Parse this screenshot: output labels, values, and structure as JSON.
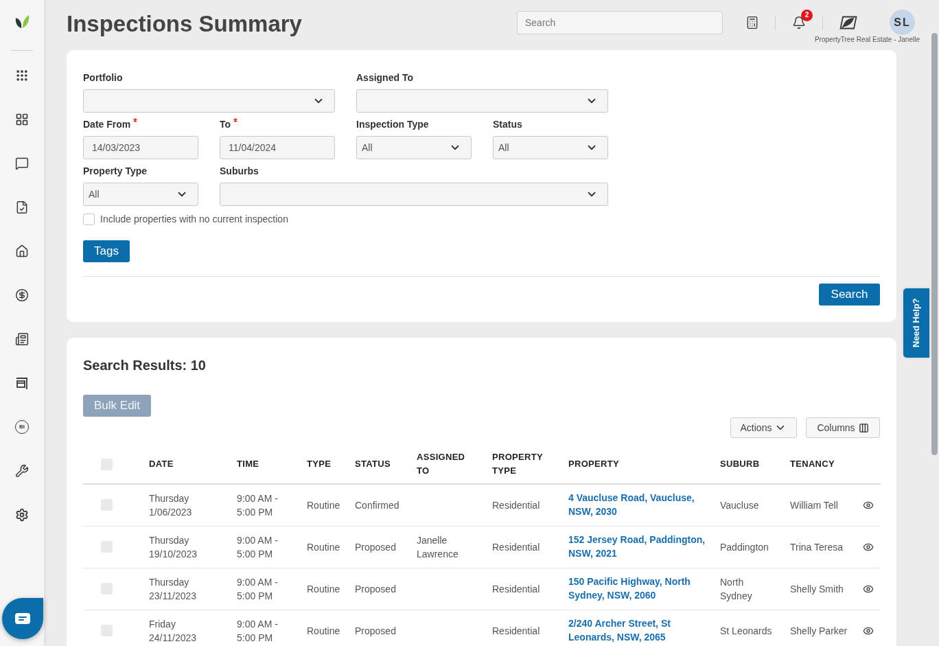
{
  "sidebar": {
    "bi_label": "BI"
  },
  "header": {
    "title": "Inspections Summary",
    "search": {
      "placeholder": "Search"
    },
    "notification_count": "2",
    "avatar_initials": "SL",
    "account_caption": "PropertyTree Real Estate - Janelle"
  },
  "filters": {
    "fields": [
      {
        "kind": "select",
        "label": "Portfolio",
        "required": false
      },
      {
        "kind": "select",
        "label": "Assigned To",
        "required": false
      },
      {
        "kind": "date",
        "label": "Date From",
        "required": true,
        "value": "14/03/2023"
      },
      {
        "kind": "date",
        "label": "To",
        "required": true,
        "value": "11/04/2024"
      },
      {
        "kind": "select",
        "label": "Inspection Type",
        "required": false,
        "value": "All"
      },
      {
        "kind": "select",
        "label": "Status",
        "required": false,
        "value": "All"
      },
      {
        "kind": "select",
        "label": "Property Type",
        "required": false,
        "value": "All"
      },
      {
        "kind": "select",
        "label": "Suburbs",
        "required": false
      }
    ],
    "include_no_inspection": {
      "label": "Include properties with no current inspection",
      "checked": false
    },
    "tags_button": "Tags",
    "search_button": "Search"
  },
  "results": {
    "title": "Search Results: 10",
    "bulk_edit": {
      "label": "Bulk Edit",
      "disabled": true
    },
    "actions_button": "Actions",
    "columns_button": "Columns",
    "table": {
      "all_selected": false,
      "columns": [
        "DATE",
        "TIME",
        "TYPE",
        "STATUS",
        "ASSIGNED TO",
        "PROPERTY TYPE",
        "PROPERTY",
        "SUBURB",
        "TENANCY"
      ],
      "rows": [
        {
          "selected": false,
          "date": "Thursday 1/06/2023",
          "time": "9:00 AM - 5:00 PM",
          "type": "Routine",
          "status": "Confirmed",
          "property_type": "Residential",
          "property": "4 Vaucluse Road, Vaucluse, NSW, 2030",
          "suburb": "Vaucluse",
          "tenancy": "William Tell"
        },
        {
          "selected": false,
          "date": "Thursday 19/10/2023",
          "time": "9:00 AM - 5:00 PM",
          "type": "Routine",
          "status": "Proposed",
          "assigned_to": "Janelle Lawrence",
          "property_type": "Residential",
          "property": "152 Jersey Road, Paddington, NSW, 2021",
          "suburb": "Paddington",
          "tenancy": "Trina Teresa"
        },
        {
          "selected": false,
          "date": "Thursday 23/11/2023",
          "time": "9:00 AM - 5:00 PM",
          "type": "Routine",
          "status": "Proposed",
          "property_type": "Residential",
          "property": "150 Pacific Highway, North Sydney, NSW, 2060",
          "suburb": "North Sydney",
          "tenancy": "Shelly Smith"
        },
        {
          "selected": false,
          "date": "Friday 24/11/2023",
          "time": "9:00 AM - 5:00 PM",
          "type": "Routine",
          "status": "Proposed",
          "property_type": "Residential",
          "property": "2/240 Archer Street, St Leonards, NSW, 2065",
          "suburb": "St Leonards",
          "tenancy": "Shelly Parker"
        }
      ]
    }
  },
  "help_tab": "Need Help?"
}
